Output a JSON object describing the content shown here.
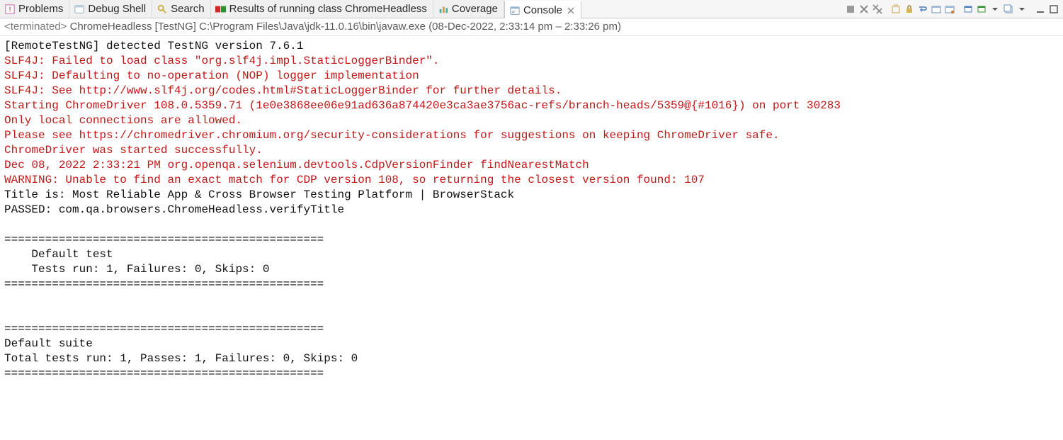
{
  "tabs": [
    {
      "label": "Problems",
      "icon": "problems-icon"
    },
    {
      "label": "Debug Shell",
      "icon": "debug-shell-icon"
    },
    {
      "label": "Search",
      "icon": "search-icon"
    },
    {
      "label": "Results of running class ChromeHeadless",
      "icon": "testng-icon"
    },
    {
      "label": "Coverage",
      "icon": "coverage-icon"
    },
    {
      "label": "Console",
      "icon": "console-icon",
      "active": true,
      "closable": true
    }
  ],
  "toolbar_icons": [
    "terminate-icon",
    "remove-launch-icon",
    "remove-all-icon",
    "clear-icon",
    "scroll-lock-icon",
    "word-wrap-icon",
    "show-console-icon",
    "pin-console-icon",
    "display-selected-icon",
    "open-console-icon",
    "view-menu-caret-icon",
    "new-view-icon",
    "view-menu-small-icon",
    "minimize-icon",
    "maximize-icon"
  ],
  "status": {
    "prefix": "<terminated>",
    "launch": "ChromeHeadless [TestNG]",
    "exe": "C:\\Program Files\\Java\\jdk-11.0.16\\bin\\javaw.exe",
    "time": "(08-Dec-2022, 2:33:14 pm – 2:33:26 pm)"
  },
  "console_lines": [
    {
      "cls": "black",
      "text": "[RemoteTestNG] detected TestNG version 7.6.1"
    },
    {
      "cls": "red",
      "text": "SLF4J: Failed to load class \"org.slf4j.impl.StaticLoggerBinder\"."
    },
    {
      "cls": "red",
      "text": "SLF4J: Defaulting to no-operation (NOP) logger implementation"
    },
    {
      "cls": "red",
      "text": "SLF4J: See http://www.slf4j.org/codes.html#StaticLoggerBinder for further details."
    },
    {
      "cls": "red",
      "text": "Starting ChromeDriver 108.0.5359.71 (1e0e3868ee06e91ad636a874420e3ca3ae3756ac-refs/branch-heads/5359@{#1016}) on port 30283"
    },
    {
      "cls": "red",
      "text": "Only local connections are allowed."
    },
    {
      "cls": "red",
      "text": "Please see https://chromedriver.chromium.org/security-considerations for suggestions on keeping ChromeDriver safe."
    },
    {
      "cls": "red",
      "text": "ChromeDriver was started successfully."
    },
    {
      "cls": "red",
      "text": "Dec 08, 2022 2:33:21 PM org.openqa.selenium.devtools.CdpVersionFinder findNearestMatch"
    },
    {
      "cls": "red",
      "text": "WARNING: Unable to find an exact match for CDP version 108, so returning the closest version found: 107"
    },
    {
      "cls": "black",
      "text": "Title is: Most Reliable App & Cross Browser Testing Platform | BrowserStack"
    },
    {
      "cls": "black",
      "text": "PASSED: com.qa.browsers.ChromeHeadless.verifyTitle"
    },
    {
      "cls": "black",
      "text": ""
    },
    {
      "cls": "black",
      "text": "==============================================="
    },
    {
      "cls": "black",
      "text": "    Default test"
    },
    {
      "cls": "black",
      "text": "    Tests run: 1, Failures: 0, Skips: 0"
    },
    {
      "cls": "black",
      "text": "==============================================="
    },
    {
      "cls": "black",
      "text": ""
    },
    {
      "cls": "black",
      "text": ""
    },
    {
      "cls": "black",
      "text": "==============================================="
    },
    {
      "cls": "black",
      "text": "Default suite"
    },
    {
      "cls": "black",
      "text": "Total tests run: 1, Passes: 1, Failures: 0, Skips: 0"
    },
    {
      "cls": "black",
      "text": "==============================================="
    }
  ]
}
